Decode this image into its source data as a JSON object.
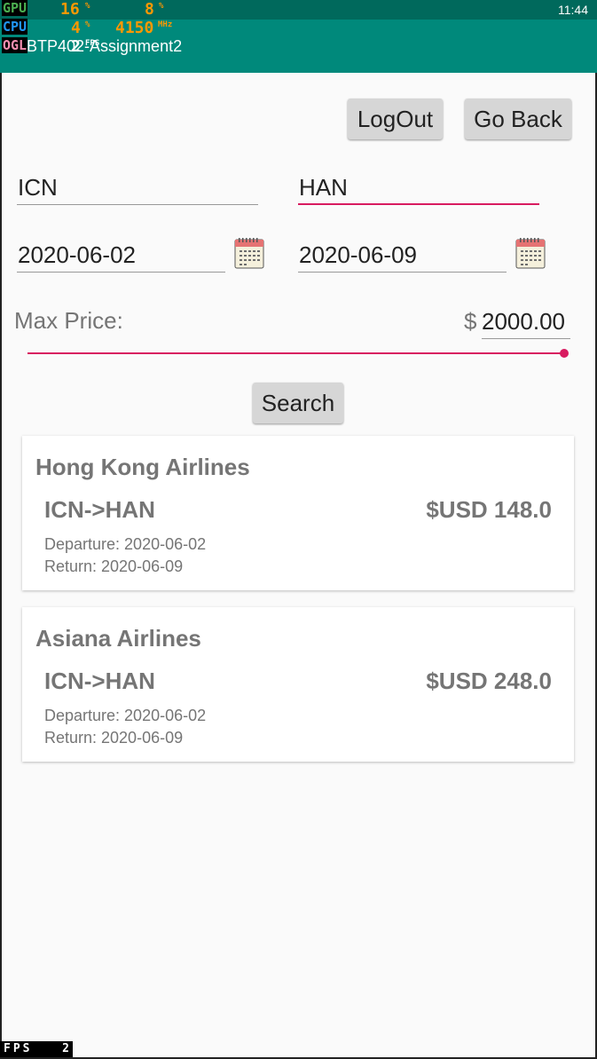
{
  "status_bar": {
    "time": "11:44"
  },
  "overlay": {
    "gpu_label": "GPU",
    "gpu_value": "16",
    "gpu_unit": "%",
    "gpu_value2": "8",
    "gpu_unit2": "%",
    "cpu_label": "CPU",
    "cpu_value": "4",
    "cpu_unit": "%",
    "cpu_freq": "4150",
    "cpu_freq_unit": "MHz",
    "ogl_label": "OGL",
    "ogl_value": "2",
    "ogl_unit": "FPS",
    "fps_label": "FPS",
    "fps_value": "2"
  },
  "app_bar": {
    "title": "BTP402-Assignment2"
  },
  "buttons": {
    "logout": "LogOut",
    "go_back": "Go Back",
    "search": "Search"
  },
  "form": {
    "origin": "ICN",
    "destination": "HAN",
    "departure_date": "2020-06-02",
    "return_date": "2020-06-09",
    "max_price_label": "Max Price:",
    "currency_symbol": "$",
    "max_price_value": "2000.00",
    "max_price_slider_fraction": 1.0
  },
  "results": [
    {
      "airline": "Hong Kong Airlines",
      "route": "ICN->HAN",
      "price": "$USD 148.0",
      "departure": "Departure: 2020-06-02",
      "return": "Return: 2020-06-09"
    },
    {
      "airline": "Asiana Airlines",
      "route": "ICN->HAN",
      "price": "$USD 248.0",
      "departure": "Departure: 2020-06-02",
      "return": "Return: 2020-06-09"
    }
  ],
  "colors": {
    "status_bar": "#00695c",
    "app_bar": "#00897b",
    "accent": "#d81b60"
  },
  "icons": [
    "calendar-icon"
  ]
}
